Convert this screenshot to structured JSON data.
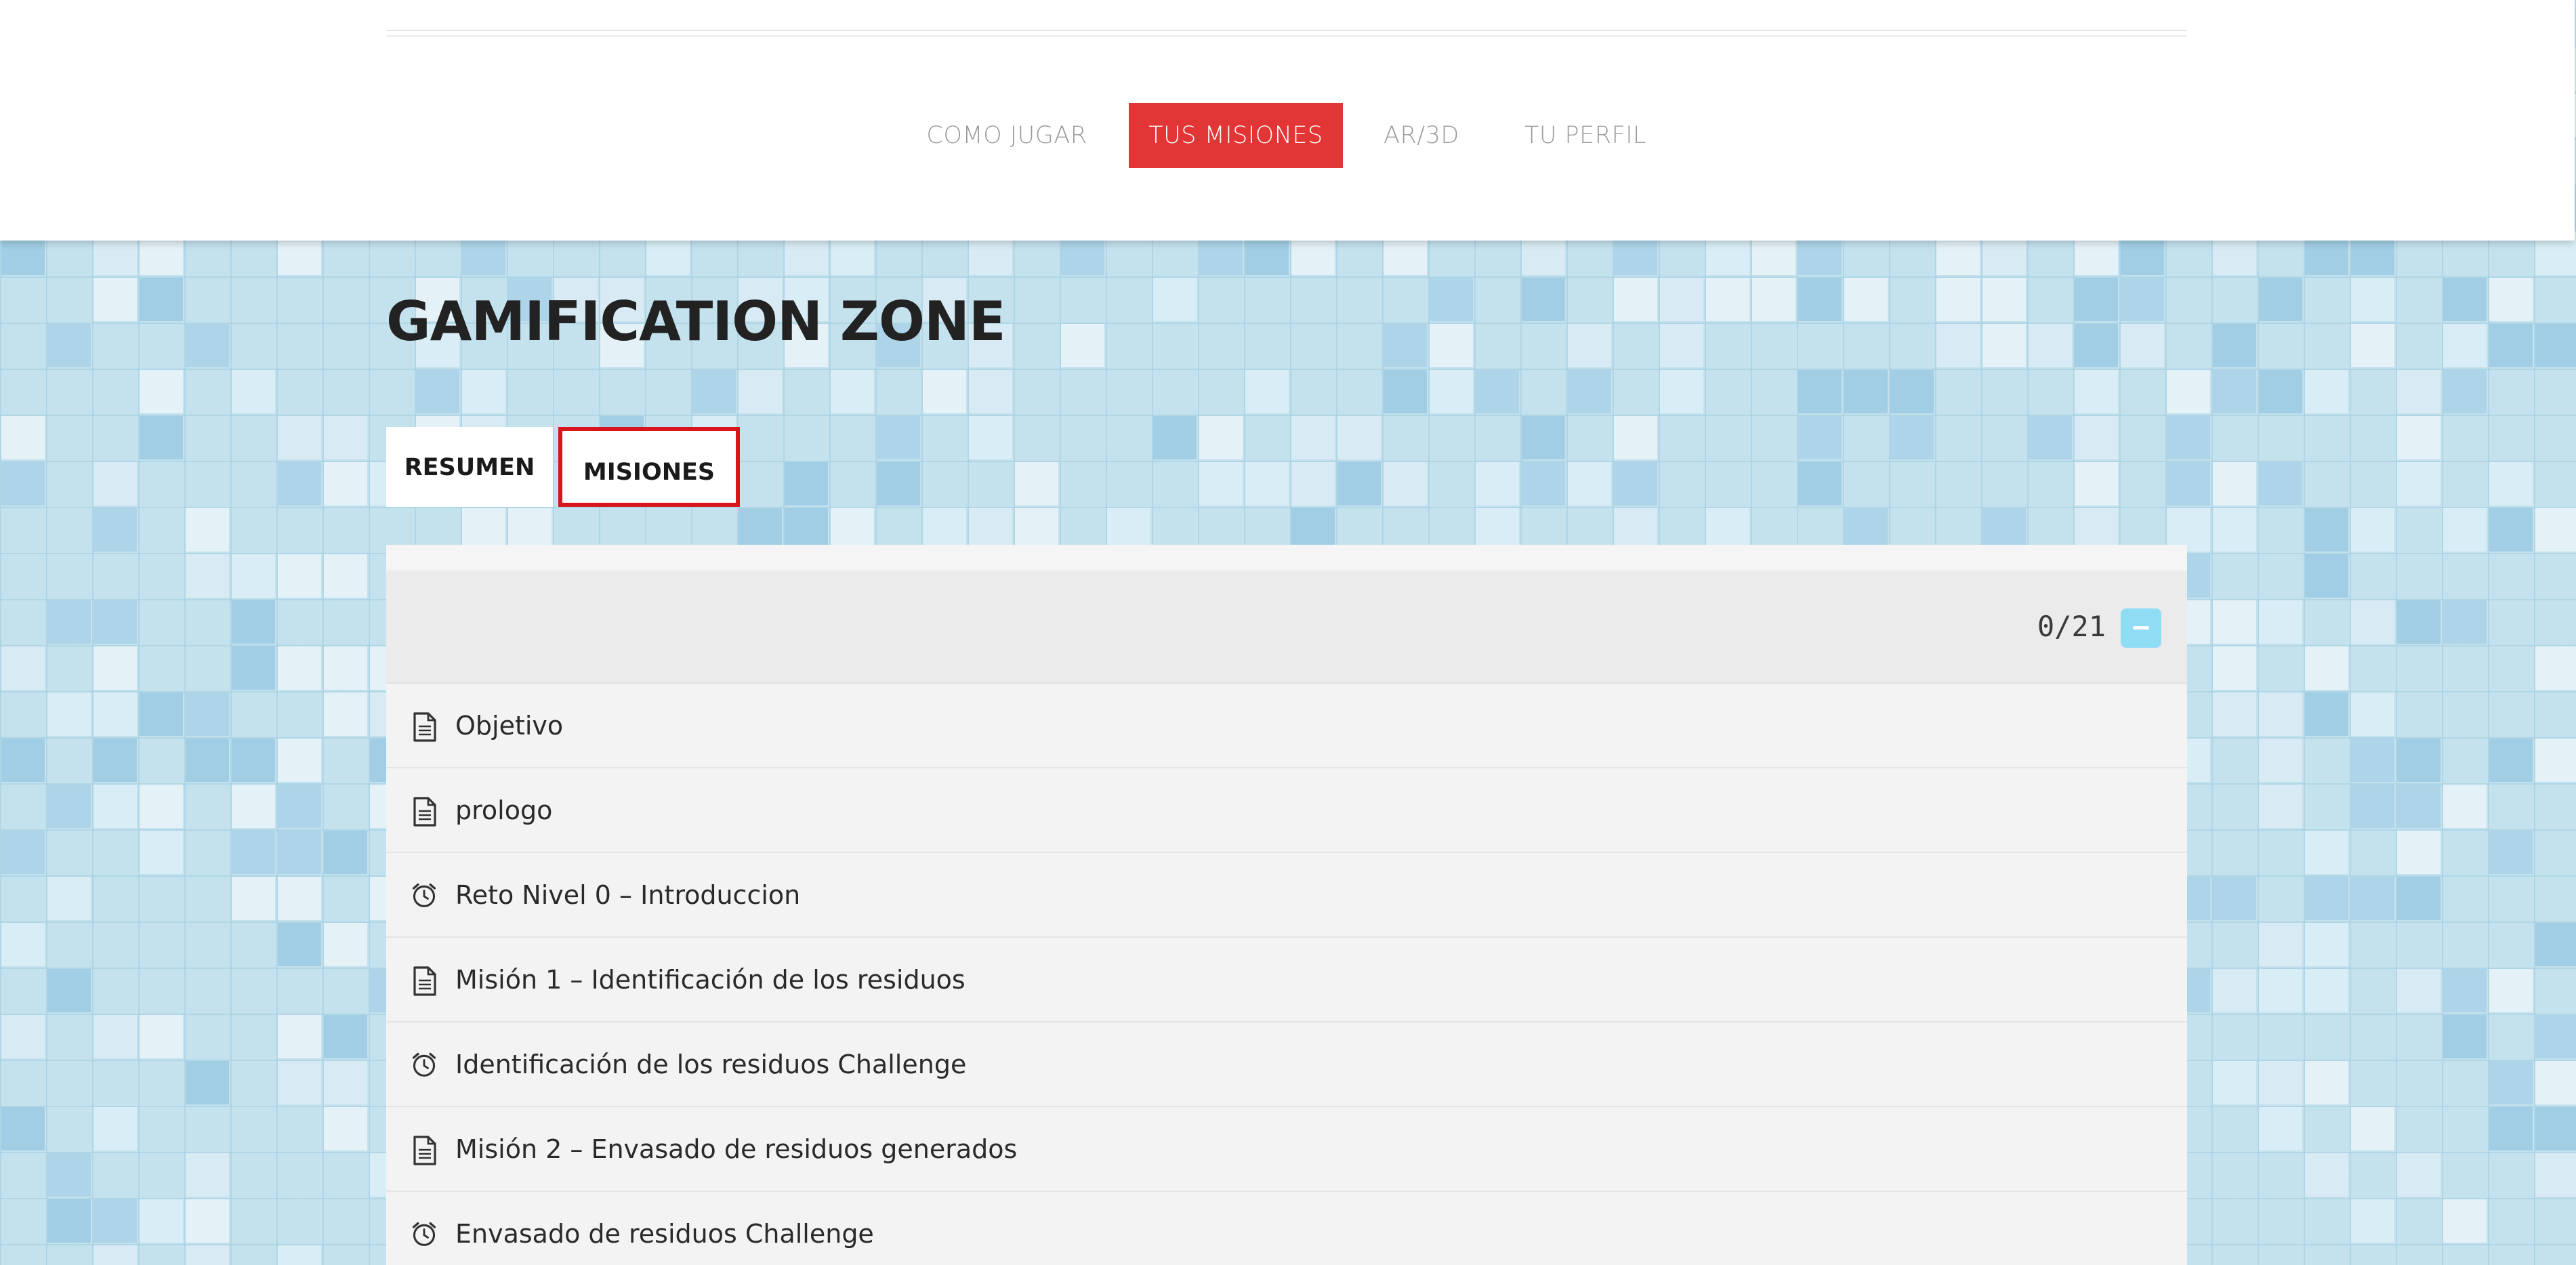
{
  "nav": {
    "items": [
      {
        "label": "COMO JUGAR",
        "active": false
      },
      {
        "label": "TUS MISIONES",
        "active": true
      },
      {
        "label": "AR/3D",
        "active": false
      },
      {
        "label": "TU PERFIL",
        "active": false
      }
    ]
  },
  "page": {
    "title": "GAMIFICATION ZONE"
  },
  "tabs": [
    {
      "label": "RESUMEN",
      "selected": false
    },
    {
      "label": "MISIONES",
      "selected": true
    }
  ],
  "missions": {
    "progress": "0/21",
    "collapse_symbol": "−",
    "items": [
      {
        "icon": "document-icon",
        "label": "Objetivo"
      },
      {
        "icon": "document-icon",
        "label": "prologo"
      },
      {
        "icon": "alarm-clock-icon",
        "label": "Reto Nivel 0 – Introduccion"
      },
      {
        "icon": "document-icon",
        "label": "Misión 1 – Identificación de los residuos"
      },
      {
        "icon": "alarm-clock-icon",
        "label": "Identificación de los residuos Challenge"
      },
      {
        "icon": "document-icon",
        "label": "Misión 2 – Envasado de residuos generados"
      },
      {
        "icon": "alarm-clock-icon",
        "label": "Envasado de residuos Challenge"
      }
    ]
  },
  "colors": {
    "accent": "#e23535",
    "selected_tab_border": "#d8141c",
    "collapse_button": "#8fdcf5",
    "background": "#c4e1ee"
  }
}
